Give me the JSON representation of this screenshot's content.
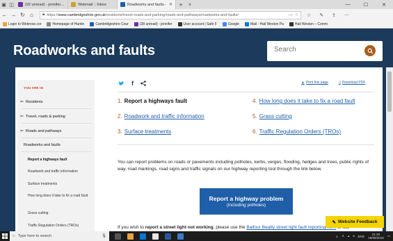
{
  "browser": {
    "tabs": [
      {
        "label": "(92 unread) - jenniferabl4",
        "favicon_color": "#6b2fa0"
      },
      {
        "label": "Webmail :: Inbox",
        "favicon_color": "#c9a227"
      },
      {
        "label": "Roadworks and faults -",
        "favicon_color": "#1f5fa8",
        "active": true
      }
    ],
    "url_host": "www.cambridgeshire.gov.uk",
    "url_path": "/residents/travel-roads-and-parking/roads-and-pathways/roadworks-and-faults/",
    "url_scheme": "https://",
    "favourites": [
      {
        "label": "Login to Webrose.cor",
        "color": "#e8a33c"
      },
      {
        "label": "Homepage of Huntin",
        "color": "#888888"
      },
      {
        "label": "Cambridgeshire Cour",
        "color": "#1f5fa8"
      },
      {
        "label": "(28 unread) - jennifer",
        "color": "#6b2fa0"
      },
      {
        "label": "User account | Safe F",
        "color": "#333333"
      },
      {
        "label": "Google",
        "color": "#4285f4"
      },
      {
        "label": "Mail - Hail Weston Pa",
        "color": "#0078d4"
      },
      {
        "label": "Hail Weston – Comm",
        "color": "#333333"
      }
    ]
  },
  "header": {
    "title": "Roadworks and faults",
    "search_placeholder": "Search"
  },
  "sidebar": {
    "heading": "YOU ARE IN",
    "crumbs": [
      "Residents",
      "Travel, roads & parking",
      "Roads and pathways"
    ],
    "section": "Roadworks and faults",
    "sub_items": [
      {
        "label": "Report a highways fault",
        "current": true
      },
      {
        "label": "Roadwork and traffic information"
      },
      {
        "label": "Surface treatments"
      },
      {
        "label": "How long does it take to fix a road fault"
      },
      {
        "label": "Grass cutting"
      },
      {
        "label": "Traffic Regulation Orders (TROs)"
      }
    ]
  },
  "tools": {
    "print": "Print this page",
    "download": "Download PDF"
  },
  "toc": [
    {
      "num": "1.",
      "label": "Report a highways fault",
      "current": true
    },
    {
      "num": "2.",
      "label": "Roadwork and traffic information"
    },
    {
      "num": "3.",
      "label": "Surface treatments"
    },
    {
      "num": "4.",
      "label": "How long does it take to fix a road fault"
    },
    {
      "num": "5.",
      "label": "Grass cutting"
    },
    {
      "num": "6.",
      "label": "Traffic Regulation Orders (TROs)"
    }
  ],
  "body": {
    "paragraph": "You can report problems on roads or pavements including potholes, kerbs, verges, flooding, hedges and trees, public rights of way, road markings, road signs and traffic signals on our highway reporting tool through the link below.",
    "cta_line1": "Report a highway problem",
    "cta_line2": "(including potholes)",
    "bottom_pre": "If you wish to ",
    "bottom_bold": "report a street light not working",
    "bottom_mid": ", please use the ",
    "bottom_link": "Balfour Beatty street light fault reporting form",
    "bottom_post": " or call"
  },
  "feedback": "Website Feedback",
  "taskbar": {
    "search_placeholder": "Type here to search",
    "lang": "ENG",
    "time": "21:20",
    "date": "16/06/2018"
  }
}
